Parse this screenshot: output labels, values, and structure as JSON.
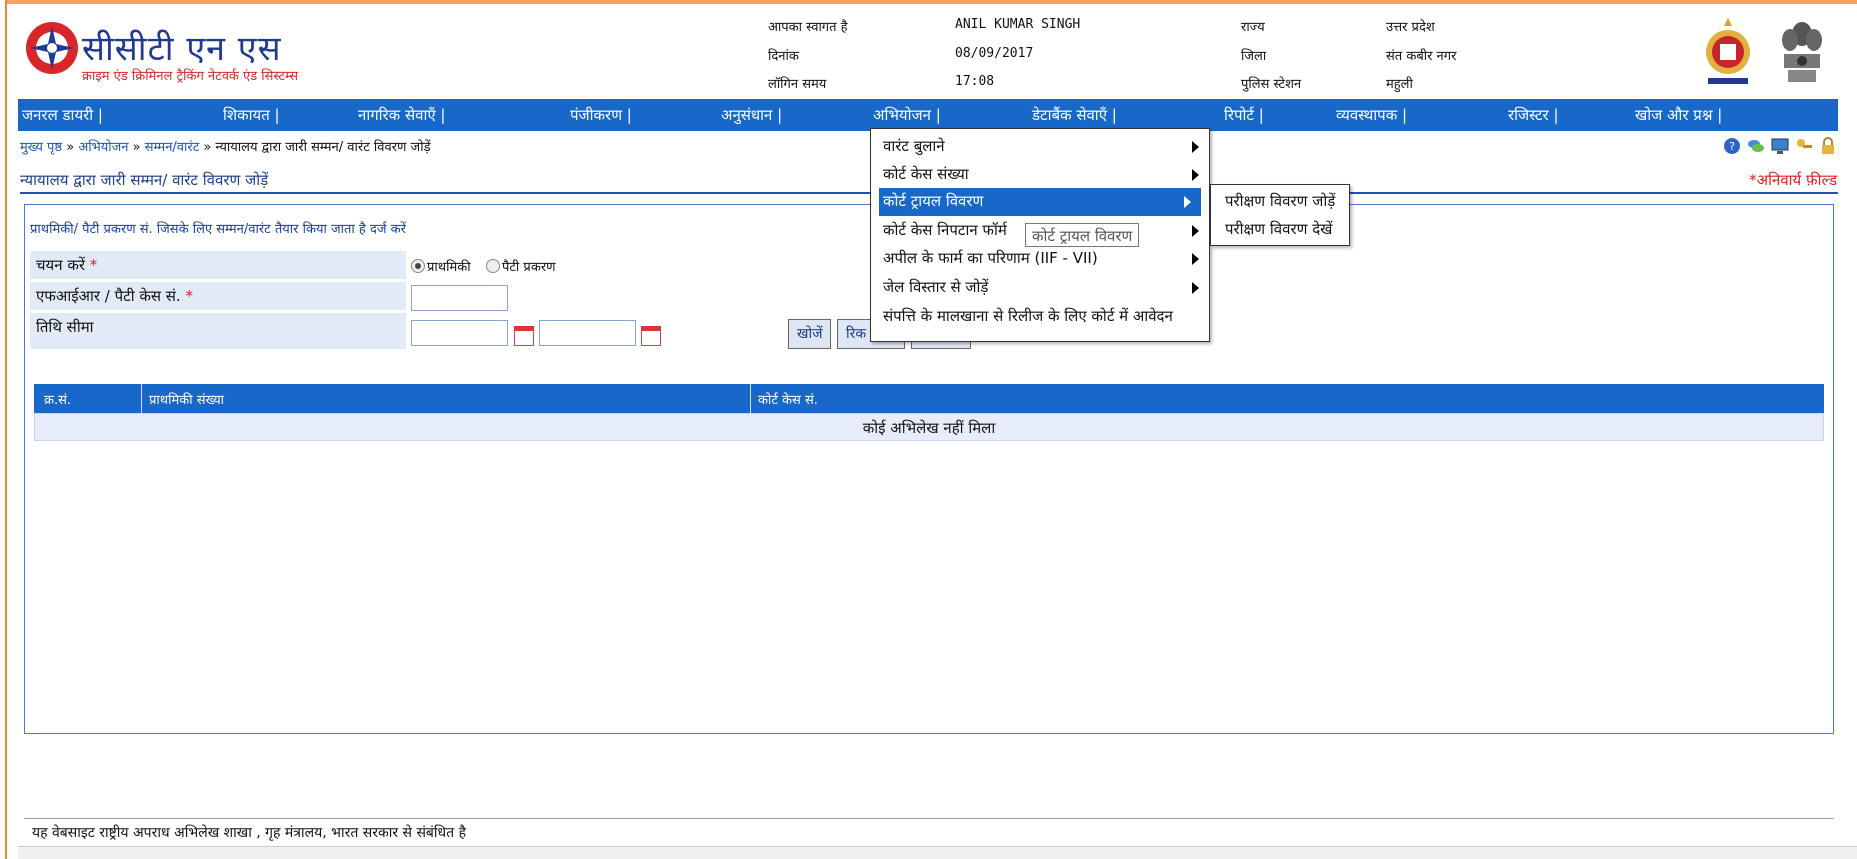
{
  "header": {
    "brand_title": "सीसीटी एन एस",
    "brand_subtitle": "क्राइम एंड क्रिमिनल ट्रैकिंग नेटवर्क एंड सिस्टम्स",
    "welcome_label": "आपका स्वागत है",
    "user_name": "ANIL KUMAR SINGH",
    "date_label": "दिनांक",
    "date_value": "08/09/2017",
    "login_time_label": "लॉगिन समय",
    "login_time_value": "17:08",
    "state_label": "राज्य",
    "state_value": "उत्तर प्रदेश",
    "district_label": "जिला",
    "district_value": "संत कबीर नगर",
    "station_label": "पुलिस स्टेशन",
    "station_value": "महुली"
  },
  "nav": {
    "items": [
      "जनरल डायरी |",
      "शिकायत |",
      "नागरिक सेवाएँ |",
      "पंजीकरण |",
      "अनुसंधान |",
      "अभियोजन |",
      "डेटाबैंक सेवाएँ |",
      "रिपोर्ट |",
      "व्यवस्थापक |",
      "रजिस्टर |",
      "खोज और प्रश्न |"
    ]
  },
  "breadcrumb": {
    "home": "मुख्य पृष्ठ",
    "sep": " » ",
    "prosecution": "अभियोजन",
    "summons": "सम्मन/वारंट",
    "current": "न्यायालय द्वारा जारी सम्मन/ वारंट विवरण जोड़ें"
  },
  "page": {
    "title": "न्यायालय द्वारा जारी सम्मन/ वारंट विवरण जोड़ें",
    "mandatory_note": "*अनिवार्य फ़ील्ड",
    "panel_heading": "प्राथमिकी/ पैटी प्रकरण सं. जिसके लिए सम्मन/वारंट तैयार किया जाता है दर्ज करें"
  },
  "form": {
    "select_label": "चयन करें",
    "required_mark": "*",
    "radio_fir": "प्राथमिकी",
    "radio_petty": "पैटी प्रकरण",
    "fir_label": "एफआईआर / पैटी केस सं.",
    "date_range_label": "तिथि सीमा",
    "search_button": "खोजें",
    "reset_button_partial": "रिक"
  },
  "table": {
    "headers": [
      "क्र.सं.",
      "प्राथमिकी संख्या",
      "कोर्ट केस सं."
    ],
    "empty_message": "कोई अभिलेख नहीं मिला"
  },
  "menu": {
    "items": [
      "वारंट बुलाने",
      "कोर्ट केस संख्या",
      "कोर्ट ट्रायल विवरण",
      "कोर्ट केस निपटान फॉर्म",
      "अपील के फार्म का परिणाम (IIF - VII)",
      "जेल विस्तार से जोड़ें",
      "संपत्ति के मालखाना से रिलीज के लिए कोर्ट में आवेदन"
    ],
    "highlighted_index": 2,
    "tooltip": "कोर्ट ट्रायल विवरण",
    "submenu": [
      "परीक्षण विवरण जोड़ें",
      "परीक्षण विवरण देखें"
    ]
  },
  "footer": {
    "text": "यह वेबसाइट राष्ट्रीय अपराध अभिलेख शाखा , गृह मंत्रालय, भारत सरकार से संबंधित है"
  },
  "colors": {
    "nav_blue": "#1768c8",
    "required_red": "#e01e1e",
    "link_blue": "#1a55c4"
  }
}
